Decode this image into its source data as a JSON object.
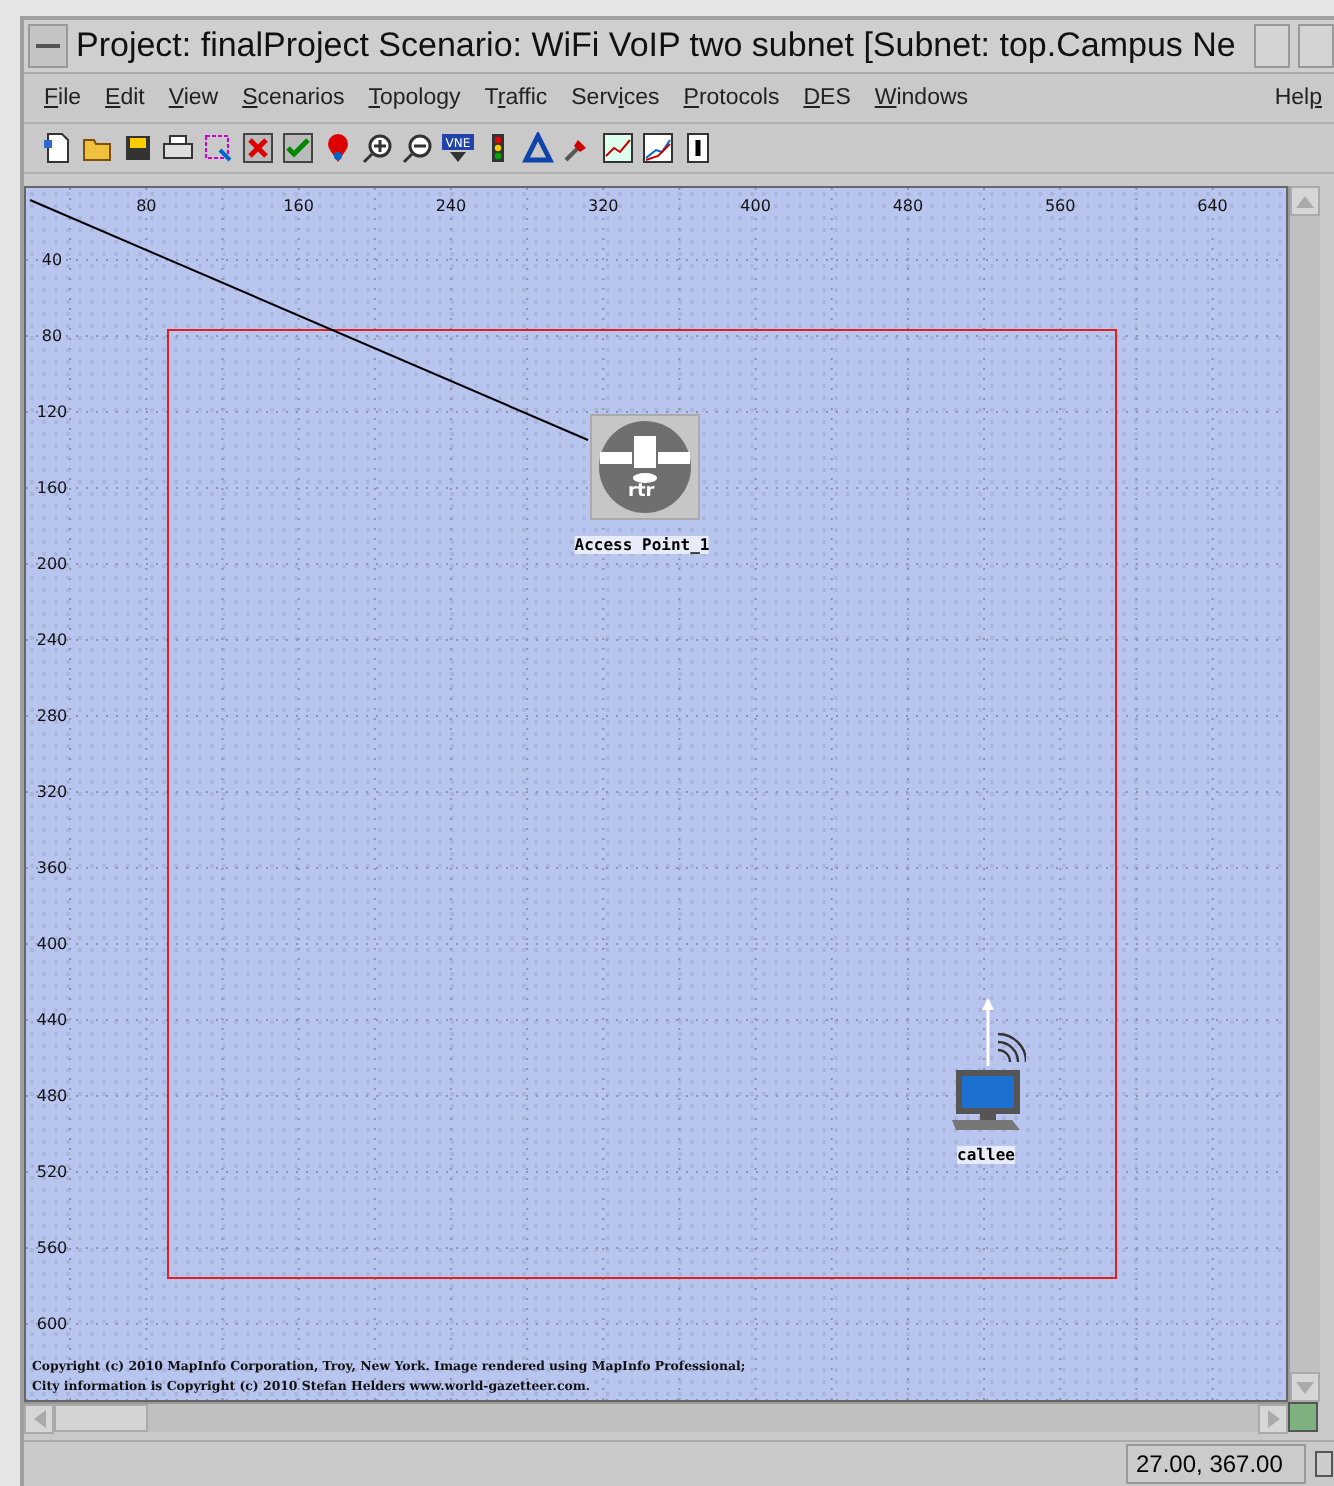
{
  "window": {
    "title": "Project: finalProject Scenario: WiFi VoIP two subnet  [Subnet: top.Campus Ne"
  },
  "menu": [
    {
      "label": "File"
    },
    {
      "label": "Edit"
    },
    {
      "label": "View"
    },
    {
      "label": "Scenarios"
    },
    {
      "label": "Topology"
    },
    {
      "label": "Traffic"
    },
    {
      "label": "Services"
    },
    {
      "label": "Protocols"
    },
    {
      "label": "DES"
    },
    {
      "label": "Windows"
    },
    {
      "label": "Help"
    }
  ],
  "toolbar": [
    {
      "kind": "new"
    },
    {
      "kind": "open"
    },
    {
      "kind": "save"
    },
    {
      "kind": "print"
    },
    {
      "kind": "select"
    },
    {
      "kind": "delete"
    },
    {
      "kind": "verify"
    },
    {
      "kind": "marker"
    },
    {
      "kind": "zoom-in"
    },
    {
      "kind": "zoom-out"
    },
    {
      "kind": "vne",
      "text": "VNE"
    },
    {
      "kind": "traffic-light"
    },
    {
      "kind": "triangle"
    },
    {
      "kind": "pin"
    },
    {
      "kind": "chart"
    },
    {
      "kind": "graph"
    },
    {
      "kind": "info"
    }
  ],
  "canvas": {
    "x_ticks": [
      "80",
      "160",
      "240",
      "320",
      "400",
      "480",
      "560",
      "640"
    ],
    "y_ticks": [
      "40",
      "80",
      "120",
      "160",
      "200",
      "240",
      "280",
      "320",
      "360",
      "400",
      "440",
      "480",
      "520",
      "560",
      "600"
    ],
    "nodes": [
      {
        "kind": "router",
        "label": "Access Point_1",
        "badge": "rtr"
      },
      {
        "kind": "workstation",
        "label": "callee"
      }
    ],
    "copyright": [
      "Copyright (c) 2010 MapInfo Corporation, Troy, New York. Image rendered using MapInfo Professional;",
      "City information is Copyright (c) 2010 Stefan Helders www.world-gazetteer.com."
    ]
  },
  "status_bar": {
    "coordinates": "27.00, 367.00"
  }
}
